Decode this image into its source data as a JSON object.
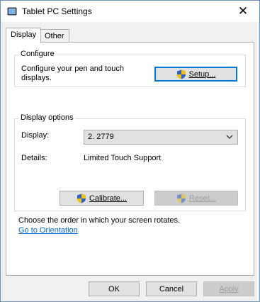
{
  "window": {
    "title": "Tablet PC Settings",
    "close_glyph": "✕"
  },
  "tabs": [
    {
      "label": "Display",
      "active": true
    },
    {
      "label": "Other",
      "active": false
    }
  ],
  "configure": {
    "legend": "Configure",
    "description": "Configure your pen and touch displays.",
    "setup_button": "Setup..."
  },
  "display_options": {
    "legend": "Display options",
    "display_label": "Display:",
    "display_value": "2. 2779",
    "details_label": "Details:",
    "details_value": "Limited Touch Support",
    "calibrate_button": "Calibrate...",
    "reset_button": "Reset..."
  },
  "orientation": {
    "text": "Choose the order in which your screen rotates.",
    "link": "Go to Orientation"
  },
  "footer": {
    "ok": "OK",
    "cancel": "Cancel",
    "apply": "Apply"
  },
  "colors": {
    "accent": "#0078d7",
    "link": "#0066cc",
    "disabled_text": "#a0a0a0"
  }
}
